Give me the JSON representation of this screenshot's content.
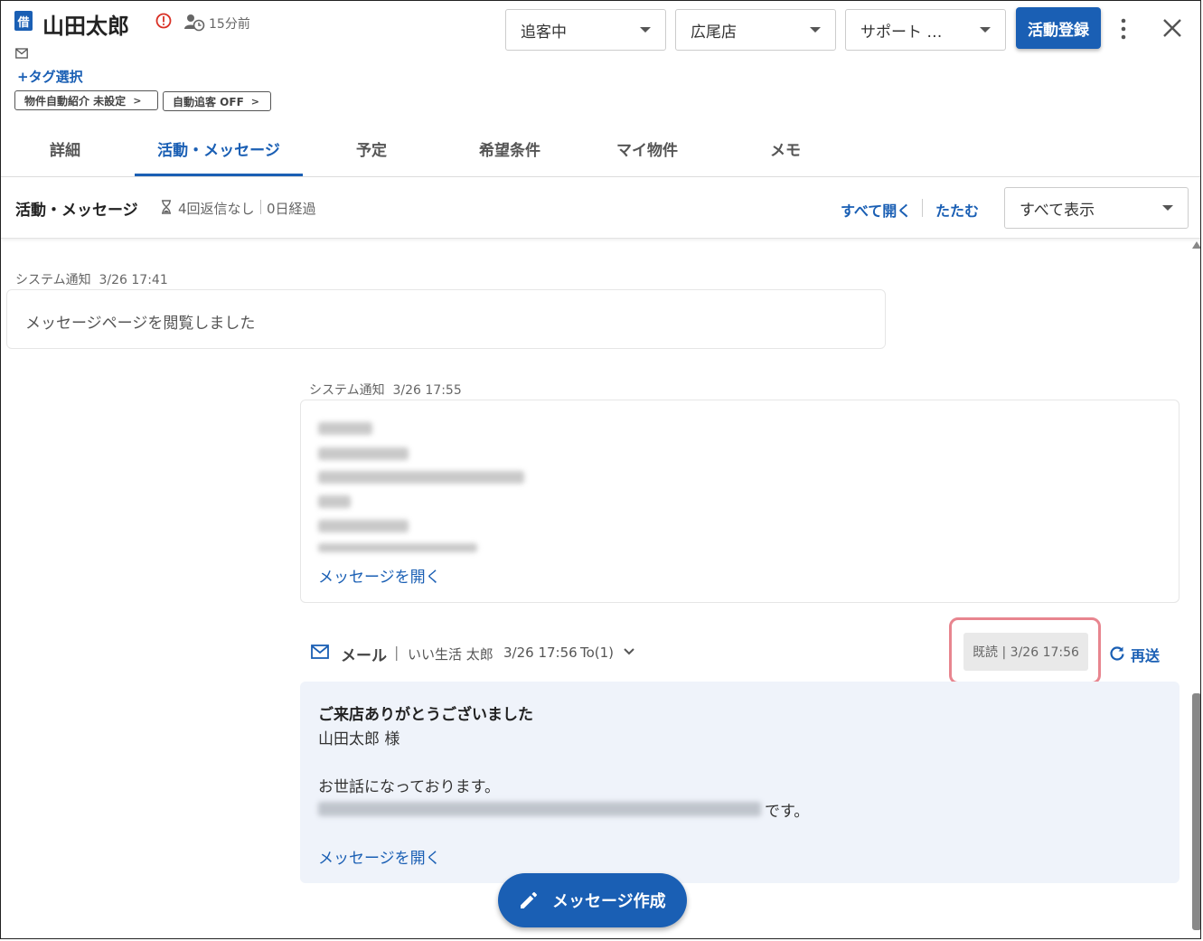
{
  "header": {
    "badge": "借",
    "customer_name": "山田太郎",
    "elapsed": "15分前",
    "email_partial": "",
    "tag_select": "+タグ選択",
    "chips": [
      {
        "label": "物件自動紹介 未設定",
        "chevron": ">"
      },
      {
        "label": "自動追客 OFF",
        "chevron": ">"
      }
    ],
    "status_dropdown": "追客中",
    "store_dropdown": "広尾店",
    "support_dropdown": "サポート …",
    "register_button": "活動登録",
    "icons": [
      "alert-icon",
      "user-clock-icon",
      "mail-icon",
      "more-vertical-icon",
      "close-icon"
    ]
  },
  "tabs": [
    {
      "label": "詳細"
    },
    {
      "label": "活動・メッセージ",
      "active": true
    },
    {
      "label": "予定"
    },
    {
      "label": "希望条件"
    },
    {
      "label": "マイ物件"
    },
    {
      "label": "メモ"
    }
  ],
  "section": {
    "title": "活動・メッセージ",
    "no_reply": "4回返信なし",
    "elapsed_days": "0日経過",
    "expand_all": "すべて開く",
    "collapse": "たたむ",
    "filter": "すべて表示"
  },
  "messages": [
    {
      "kind": "システム通知",
      "time": "3/26 17:41",
      "body": "メッセージページを閲覧しました"
    },
    {
      "kind": "システム通知",
      "time": "3/26 17:55",
      "open_link": "メッセージを開く"
    }
  ],
  "mail": {
    "type": "メール",
    "separator": "|",
    "sender": "いい生活 太郎",
    "time": "3/26 17:56",
    "to": "To(1)",
    "read_status": "既読 | 3/26 17:56",
    "resend": "再送",
    "subject": "ご来店ありがとうございました",
    "greeting": "山田太郎 様",
    "line1": "お世話になっております。",
    "line2_suffix": "です。",
    "open_link": "メッセージを開く"
  },
  "compose_button": "メッセージ作成",
  "colors": {
    "accent": "#1a5fb4",
    "highlight": "#e8858f",
    "mail_bg": "#eff3fa"
  }
}
